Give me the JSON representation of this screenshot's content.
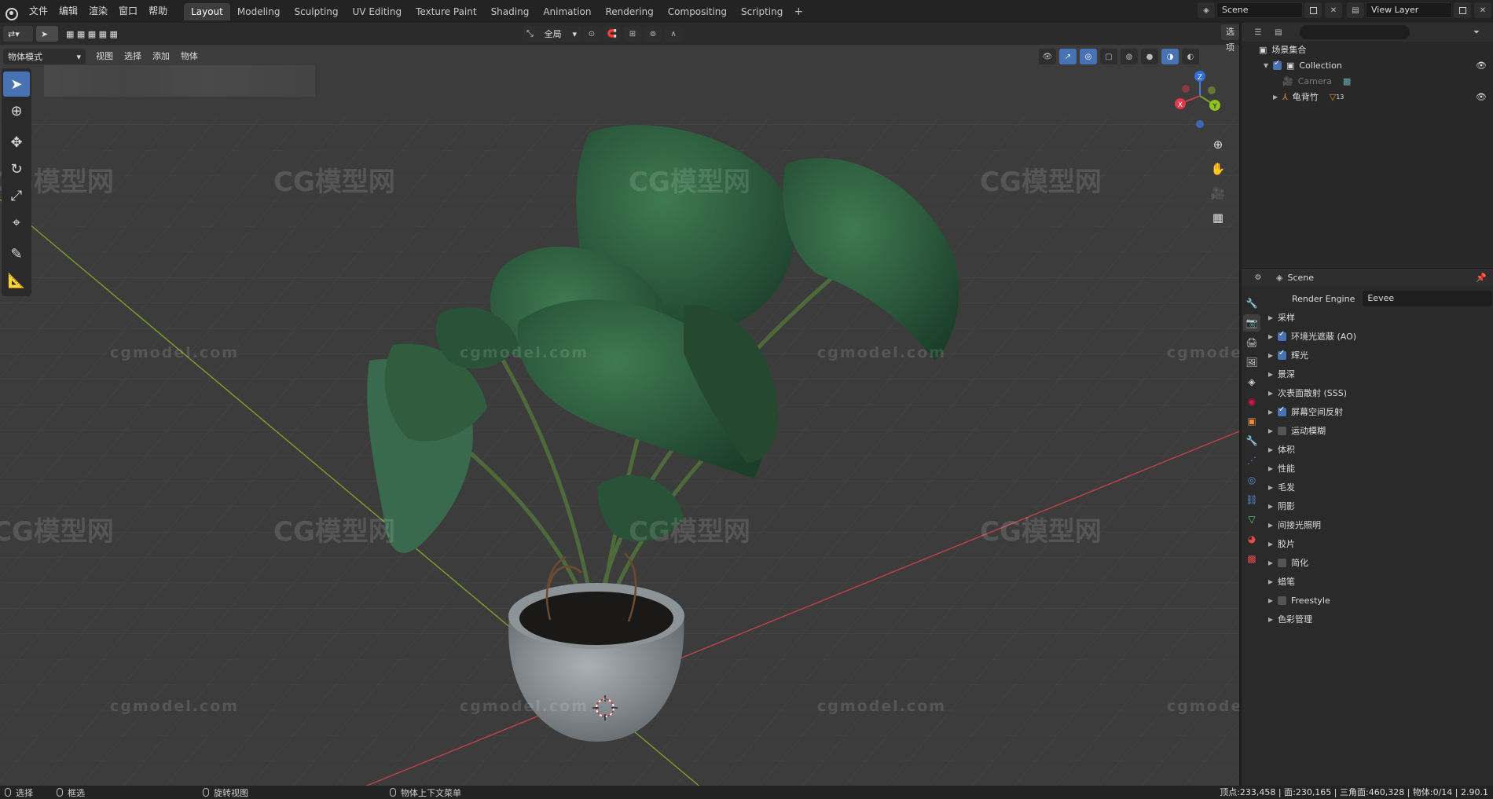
{
  "menubar": {
    "menus": [
      "文件",
      "编辑",
      "渲染",
      "窗口",
      "帮助"
    ],
    "workspaces": [
      "Layout",
      "Modeling",
      "Sculpting",
      "UV Editing",
      "Texture Paint",
      "Shading",
      "Animation",
      "Rendering",
      "Compositing",
      "Scripting"
    ],
    "active_workspace": "Layout",
    "add_tab": "+",
    "scene": "Scene",
    "view_layer": "View Layer"
  },
  "viewport_header": {
    "mode": "物体模式",
    "menus": [
      "视图",
      "选择",
      "添加",
      "物体"
    ],
    "transform_orientation": "全局",
    "options": "选项"
  },
  "gizmo": {
    "x": "X",
    "y": "Y",
    "z": "Z"
  },
  "watermarks": {
    "cn": "CG模型网",
    "url": "cgmodel.com"
  },
  "outliner": {
    "search_placeholder": "",
    "root": "场景集合",
    "collection": "Collection",
    "items": [
      {
        "name": "Camera",
        "visible": false
      },
      {
        "name": "龟背竹",
        "visible": true,
        "badge": "13"
      }
    ]
  },
  "properties": {
    "context": "Scene",
    "render_engine_label": "Render Engine",
    "render_engine": "Eevee",
    "sections": [
      {
        "label": "采样",
        "checkbox": null
      },
      {
        "label": "环境光遮蔽 (AO)",
        "checkbox": true
      },
      {
        "label": "辉光",
        "checkbox": true
      },
      {
        "label": "景深",
        "checkbox": null
      },
      {
        "label": "次表面散射 (SSS)",
        "checkbox": null
      },
      {
        "label": "屏幕空间反射",
        "checkbox": true
      },
      {
        "label": "运动模糊",
        "checkbox": false
      },
      {
        "label": "体积",
        "checkbox": null
      },
      {
        "label": "性能",
        "checkbox": null
      },
      {
        "label": "毛发",
        "checkbox": null
      },
      {
        "label": "阴影",
        "checkbox": null
      },
      {
        "label": "间接光照明",
        "checkbox": null
      },
      {
        "label": "胶片",
        "checkbox": null
      },
      {
        "label": "简化",
        "checkbox": false
      },
      {
        "label": "蜡笔",
        "checkbox": null
      },
      {
        "label": "Freestyle",
        "checkbox": false
      },
      {
        "label": "色彩管理",
        "checkbox": null
      }
    ]
  },
  "statusbar": {
    "select": "选择",
    "box_select": "框选",
    "rotate_view": "旋转视图",
    "context_menu": "物体上下文菜单",
    "stats": "顶点:233,458 | 面:230,165 | 三角面:460,328 | 物体:0/14 | 2.90.1"
  },
  "colors": {
    "accent": "#4772b3",
    "x_axis": "#c1414b",
    "y_axis": "#7f9f2a",
    "leaf": "#2f5d3e",
    "pot": "#8f9699"
  }
}
